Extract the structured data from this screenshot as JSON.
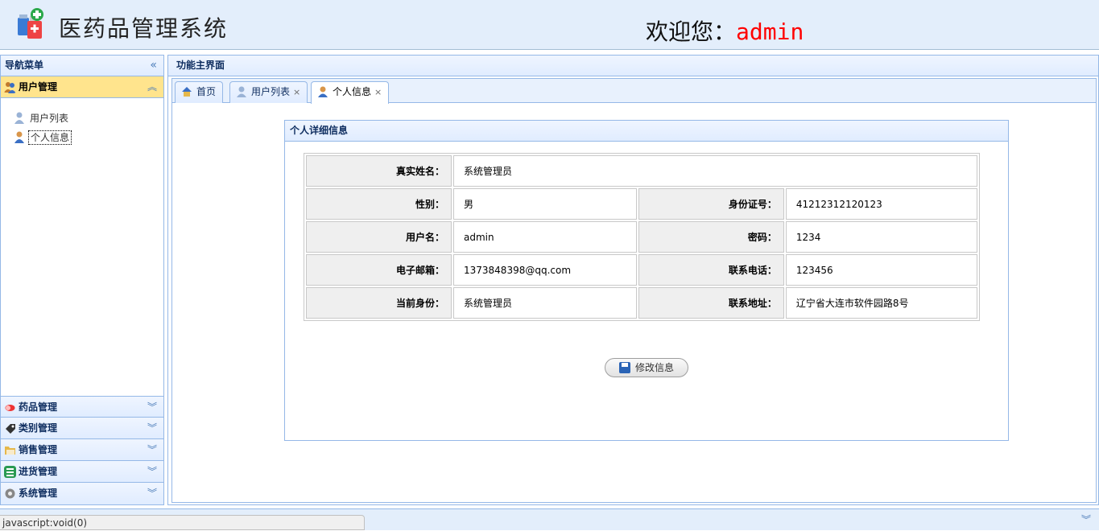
{
  "header": {
    "app_title": "医药品管理系统",
    "welcome_prefix": "欢迎您：",
    "username": "admin",
    "logo_icon": "medicine-bottles-icon"
  },
  "sidebar": {
    "title": "导航菜单",
    "collapse_icon": "double-chevron-left-icon",
    "sections": [
      {
        "label": "用户管理",
        "icon": "users-icon",
        "expanded": true,
        "items": [
          {
            "label": "用户列表",
            "icon": "user-list-icon"
          },
          {
            "label": "个人信息",
            "icon": "user-icon",
            "selected": true
          }
        ]
      },
      {
        "label": "药品管理",
        "icon": "pill-icon"
      },
      {
        "label": "类别管理",
        "icon": "tag-icon"
      },
      {
        "label": "销售管理",
        "icon": "folder-icon"
      },
      {
        "label": "进货管理",
        "icon": "list-icon"
      },
      {
        "label": "系统管理",
        "icon": "gear-icon"
      }
    ]
  },
  "main": {
    "title": "功能主界面",
    "tabs": [
      {
        "label": "首页",
        "icon": "home-icon",
        "closable": false
      },
      {
        "label": "用户列表",
        "icon": "user-list-icon",
        "closable": true
      },
      {
        "label": "个人信息",
        "icon": "user-icon",
        "closable": true,
        "active": true
      }
    ],
    "close_glyph": "×"
  },
  "detail": {
    "title": "个人详细信息",
    "fields": {
      "real_name": {
        "label": "真实姓名：",
        "value": "系统管理员"
      },
      "gender": {
        "label": "性别：",
        "value": "男"
      },
      "id_number": {
        "label": "身份证号：",
        "value": "41212312120123"
      },
      "username": {
        "label": "用户名：",
        "value": "admin"
      },
      "password": {
        "label": "密码：",
        "value": "1234"
      },
      "email": {
        "label": "电子邮箱：",
        "value": "1373848398@qq.com"
      },
      "phone": {
        "label": "联系电话：",
        "value": "123456"
      },
      "role": {
        "label": "当前身份：",
        "value": "系统管理员"
      },
      "address": {
        "label": "联系地址：",
        "value": "辽宁省大连市软件园路8号"
      }
    },
    "edit_button": "修改信息"
  },
  "status": {
    "text": "javascript:void(0)"
  },
  "colors": {
    "accent": "#95b8e7",
    "active_section": "#ffe48d",
    "welcome_user": "#ff0000"
  }
}
